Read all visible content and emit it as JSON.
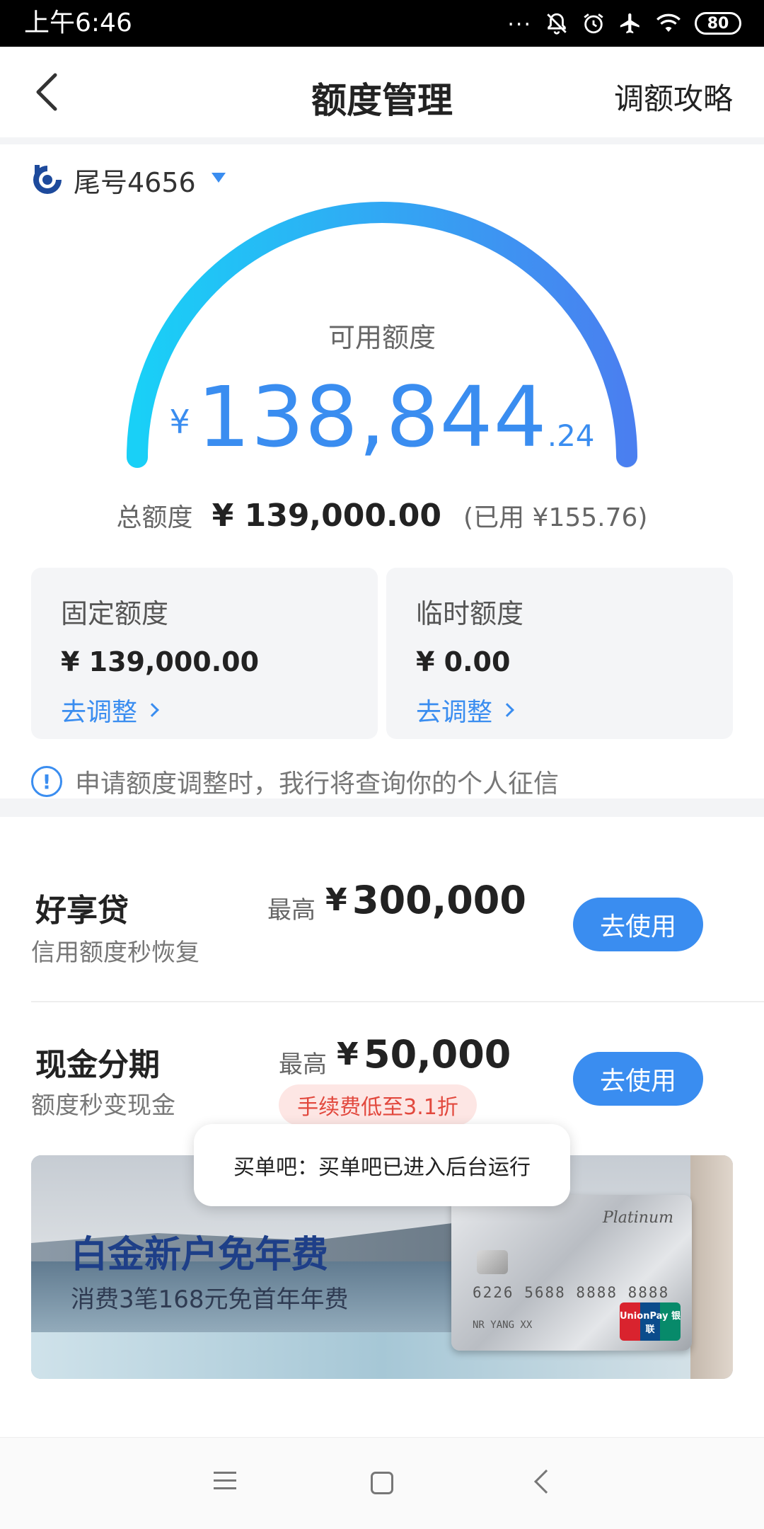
{
  "status_bar": {
    "time": "上午6:46",
    "dots": "...",
    "battery": "80",
    "icons": [
      "bell-off-icon",
      "alarm-icon",
      "airplane-icon",
      "wifi-icon",
      "battery-icon"
    ]
  },
  "header": {
    "title": "额度管理",
    "right_link": "调额攻略"
  },
  "card": {
    "label": "尾号4656"
  },
  "available": {
    "label": "可用额度",
    "currency": "¥",
    "amount_main": "138,844",
    "amount_decimal": ".24",
    "used_fraction": 0.0011
  },
  "total": {
    "label": "总额度",
    "amount": "¥ 139,000.00",
    "used": "(已用 ¥155.76)"
  },
  "quota_boxes": [
    {
      "title": "固定额度",
      "amount": "¥ 139,000.00",
      "link": "去调整"
    },
    {
      "title": "临时额度",
      "amount": "¥ 0.00",
      "link": "去调整"
    }
  ],
  "notice": {
    "icon_text": "!",
    "text": "申请额度调整时，我行将查询你的个人征信"
  },
  "products": [
    {
      "name": "好享贷",
      "desc": "信用额度秒恢复",
      "max_label": "最高",
      "currency": "¥",
      "max_amount": "300,000",
      "button": "去使用"
    },
    {
      "name": "现金分期",
      "desc": "额度秒变现金",
      "max_label": "最高",
      "currency": "¥",
      "max_amount": "50,000",
      "tag": "手续费低至3.1折",
      "button": "去使用"
    }
  ],
  "banner": {
    "headline": "白金新户免年费",
    "subline": "消费3笔168元免首年年费",
    "card_text": "Platinum",
    "card_number": "6226 5688 8888 8888",
    "card_holder": "NR YANG XX",
    "card_network": "UnionPay 银联"
  },
  "toast": {
    "text": "买单吧：买单吧已进入后台运行"
  },
  "colors": {
    "accent": "#3a8df0",
    "gauge_start": "#19d0f7",
    "gauge_end": "#4a7ff0",
    "tag_bg": "#fde6e4",
    "tag_text": "#e2483d"
  }
}
